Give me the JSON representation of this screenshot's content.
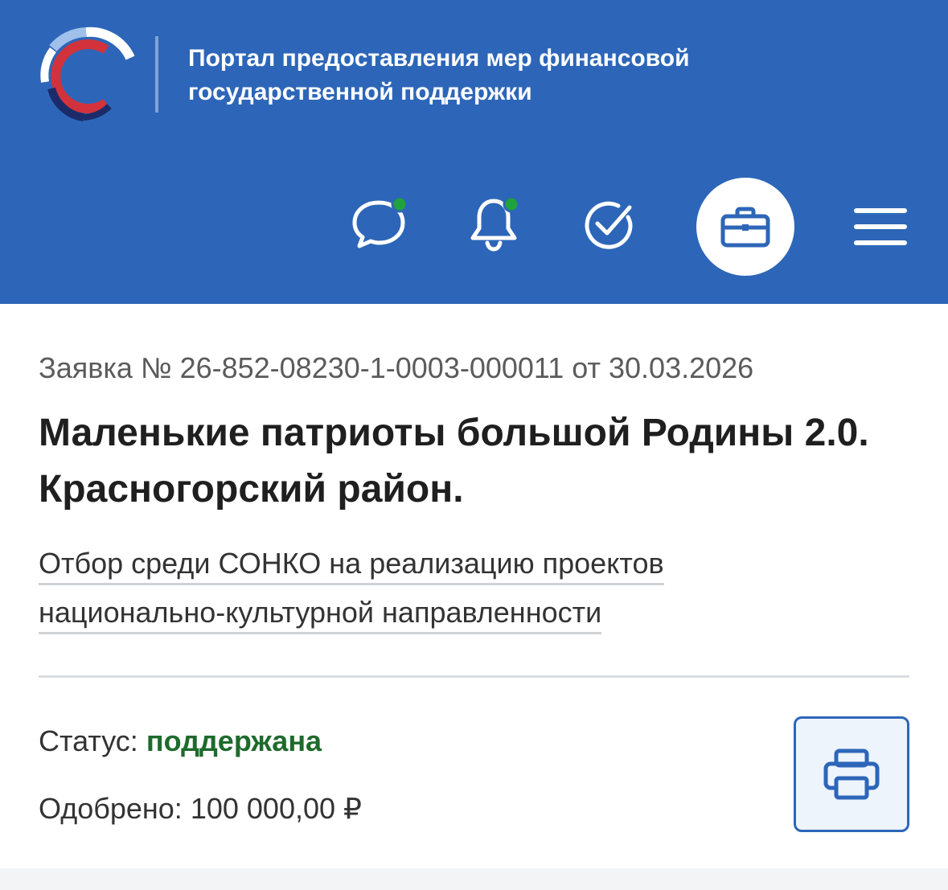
{
  "header": {
    "portal_title": "Портал предоставления мер финансовой государственной поддержки",
    "background_color": "#2d66b8",
    "icons": [
      "chat-icon",
      "bell-icon",
      "check-circle-icon",
      "briefcase-icon",
      "menu-icon"
    ],
    "notification_dot_color": "#1fa33a"
  },
  "application": {
    "number_line": "Заявка № 26-852-08230-1-0003-000011 от 30.03.2026",
    "title": "Маленькие патриоты большой Родины 2.0. Красногорский район.",
    "selection_link": "Отбор среди СОНКО на реализацию проектов национально-культурной направленности",
    "status_label": "Статус:",
    "status_value": "поддержана",
    "status_color": "#1e6b2c",
    "approved_label": "Одобрено:",
    "approved_value": "100 000,00 ₽",
    "print_icon": "printer-icon"
  }
}
